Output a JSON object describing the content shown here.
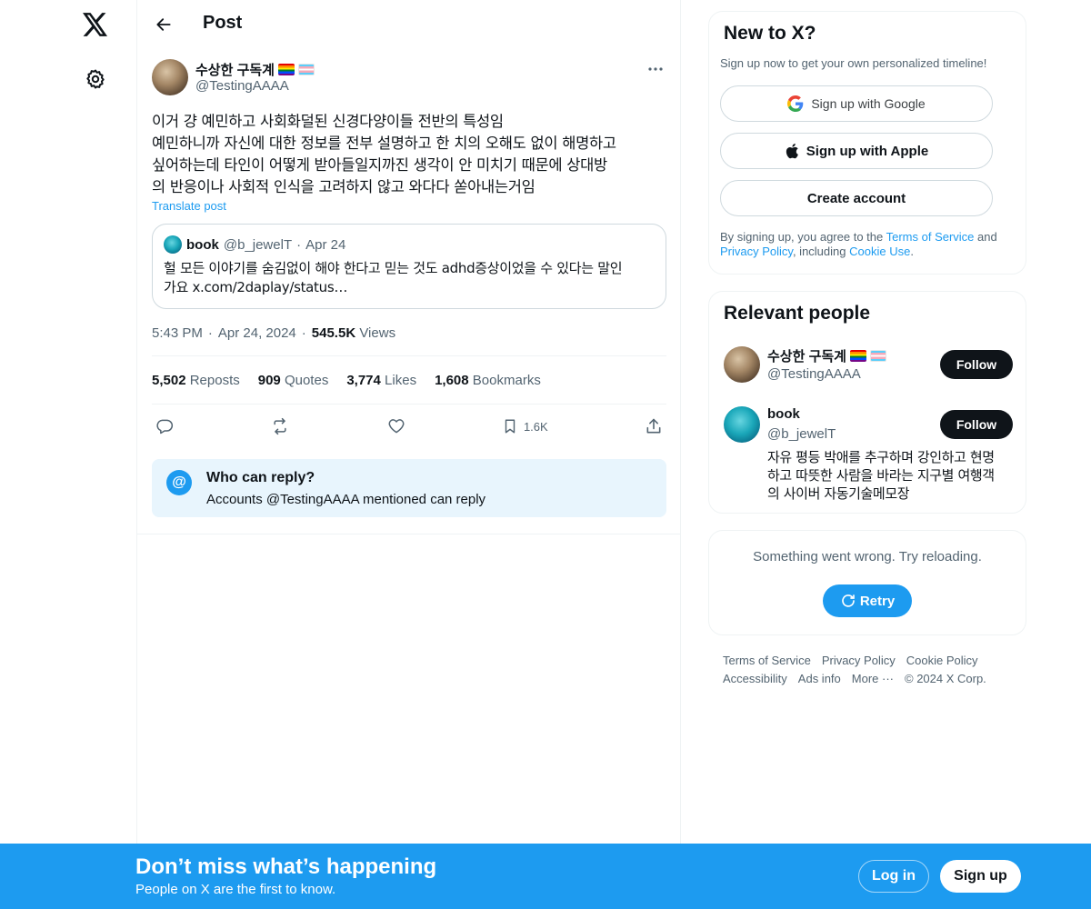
{
  "nav": {
    "logo_icon": "x-logo-icon",
    "settings_icon": "gear-icon"
  },
  "header": {
    "title": "Post"
  },
  "post": {
    "author_name": "수상한 구독계",
    "author_handle": "@TestingAAAA",
    "text": "이거 걍 예민하고 사회화덜된 신경다양이들 전반의 특성임\n예민하니까 자신에 대한 정보를 전부 설명하고 한 치의 오해도 없이 해명하고\n싶어하는데 타인이 어떻게 받아들일지까진 생각이 안 미치기 때문에 상대방\n의 반응이나 사회적 인식을 고려하지 않고 와다다 쏟아내는거임",
    "translate_label": "Translate post",
    "quote": {
      "name": "book",
      "handle": "@b_jewelT",
      "separator": "·",
      "date": "Apr 24",
      "text": "헐 모든 이야기를 숨김없이 해야 한다고 믿는 것도 adhd증상이었을 수 있다는 말인\n가요 x.com/2daplay/status…"
    },
    "time": "5:43 PM",
    "date": "Apr 24, 2024",
    "dot": "·",
    "views_count": "545.5K",
    "views_label": "Views",
    "stats": {
      "reposts_count": "5,502",
      "reposts_label": "Reposts",
      "quotes_count": "909",
      "quotes_label": "Quotes",
      "likes_count": "3,774",
      "likes_label": "Likes",
      "bookmarks_count": "1,608",
      "bookmarks_label": "Bookmarks"
    },
    "actions": {
      "bookmark_count": "1.6K"
    },
    "reply_settings": {
      "icon": "@",
      "title": "Who can reply?",
      "subtitle": "Accounts @TestingAAAA mentioned can reply"
    }
  },
  "sidebar": {
    "new_to_x": {
      "title": "New to X?",
      "subtitle": "Sign up now to get your own personalized timeline!",
      "google_label": "Sign up with Google",
      "apple_label": "Sign up with Apple",
      "create_label": "Create account",
      "legal_prefix": "By signing up, you agree to the ",
      "terms_link": "Terms of Service",
      "legal_and": " and",
      "privacy_link": "Privacy Policy",
      "legal_including": ", including ",
      "cookie_link": "Cookie Use",
      "legal_end": "."
    },
    "relevant_people": {
      "title": "Relevant people",
      "people": [
        {
          "name": "수상한 구독계",
          "handle": "@TestingAAAA",
          "follow_label": "Follow",
          "bio": ""
        },
        {
          "name": "book",
          "handle": "@b_jewelT",
          "follow_label": "Follow",
          "bio": "자유 평등 박애를 추구하며 강인하고 현명하고 따뜻한 사람을 바라는 지구별 여행객의 사이버 자동기술메모장"
        }
      ]
    },
    "error": {
      "text": "Something went wrong. Try reloading.",
      "retry_label": "Retry"
    },
    "footer": {
      "terms": "Terms of Service",
      "privacy": "Privacy Policy",
      "cookie": "Cookie Policy",
      "accessibility": "Accessibility",
      "ads": "Ads info",
      "more": "More ···",
      "copyright": "© 2024 X Corp."
    }
  },
  "banner": {
    "title": "Don’t miss what’s happening",
    "subtitle": "People on X are the first to know.",
    "login_label": "Log in",
    "signup_label": "Sign up"
  },
  "colors": {
    "accent": "#1d9bf0",
    "text": "#0f1419",
    "secondary": "#536471",
    "border": "#eff3f4"
  }
}
